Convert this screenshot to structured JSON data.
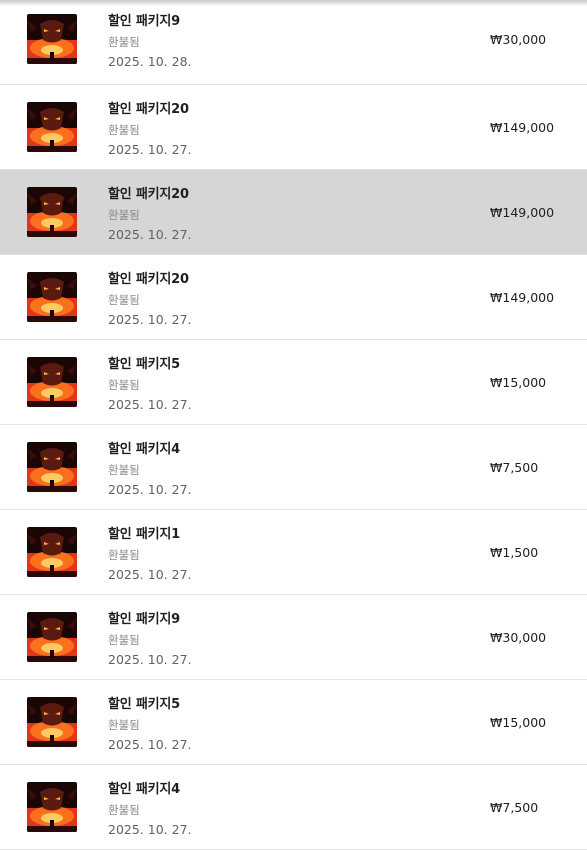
{
  "purchases": [
    {
      "title": "할인 패키지9",
      "status": "환불됨",
      "date": "2025. 10. 28.",
      "price": "₩30,000"
    },
    {
      "title": "할인 패키지20",
      "status": "환불됨",
      "date": "2025. 10. 27.",
      "price": "₩149,000"
    },
    {
      "title": "할인 패키지20",
      "status": "환불됨",
      "date": "2025. 10. 27.",
      "price": "₩149,000"
    },
    {
      "title": "할인 패키지20",
      "status": "환불됨",
      "date": "2025. 10. 27.",
      "price": "₩149,000"
    },
    {
      "title": "할인 패키지5",
      "status": "환불됨",
      "date": "2025. 10. 27.",
      "price": "₩15,000"
    },
    {
      "title": "할인 패키지4",
      "status": "환불됨",
      "date": "2025. 10. 27.",
      "price": "₩7,500"
    },
    {
      "title": "할인 패키지1",
      "status": "환불됨",
      "date": "2025. 10. 27.",
      "price": "₩1,500"
    },
    {
      "title": "할인 패키지9",
      "status": "환불됨",
      "date": "2025. 10. 27.",
      "price": "₩30,000"
    },
    {
      "title": "할인 패키지5",
      "status": "환불됨",
      "date": "2025. 10. 27.",
      "price": "₩15,000"
    },
    {
      "title": "할인 패키지4",
      "status": "환불됨",
      "date": "2025. 10. 27.",
      "price": "₩7,500"
    }
  ],
  "selected_index": 2,
  "colors": {
    "selected_row": "#d6d6d6",
    "divider": "#e3e3e3",
    "title": "#1f1f1f",
    "status": "#8a8a8a",
    "date": "#5f6368"
  },
  "icons": {
    "thumbnail": "game-app-icon"
  }
}
